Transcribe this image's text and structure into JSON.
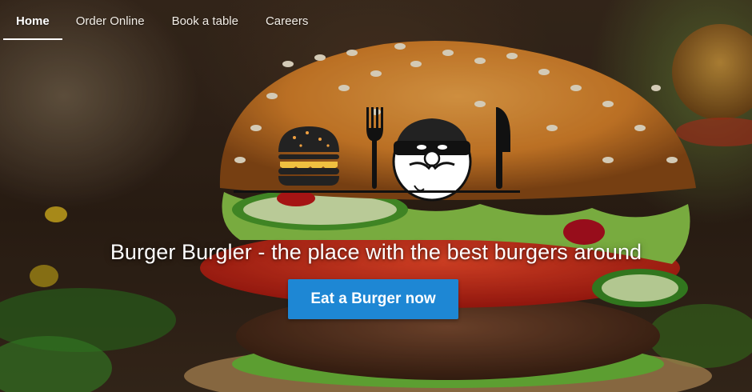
{
  "nav": {
    "items": [
      {
        "label": "Home",
        "active": true
      },
      {
        "label": "Order Online",
        "active": false
      },
      {
        "label": "Book a table",
        "active": false
      },
      {
        "label": "Careers",
        "active": false
      }
    ]
  },
  "hero": {
    "headline": "Burger Burgler - the place with the best burgers around",
    "cta_label": "Eat a Burger now",
    "background": "burger-photo",
    "logo": "burger-burgler-logo",
    "colors": {
      "cta": "#1e87d4",
      "text": "#ffffff"
    }
  }
}
